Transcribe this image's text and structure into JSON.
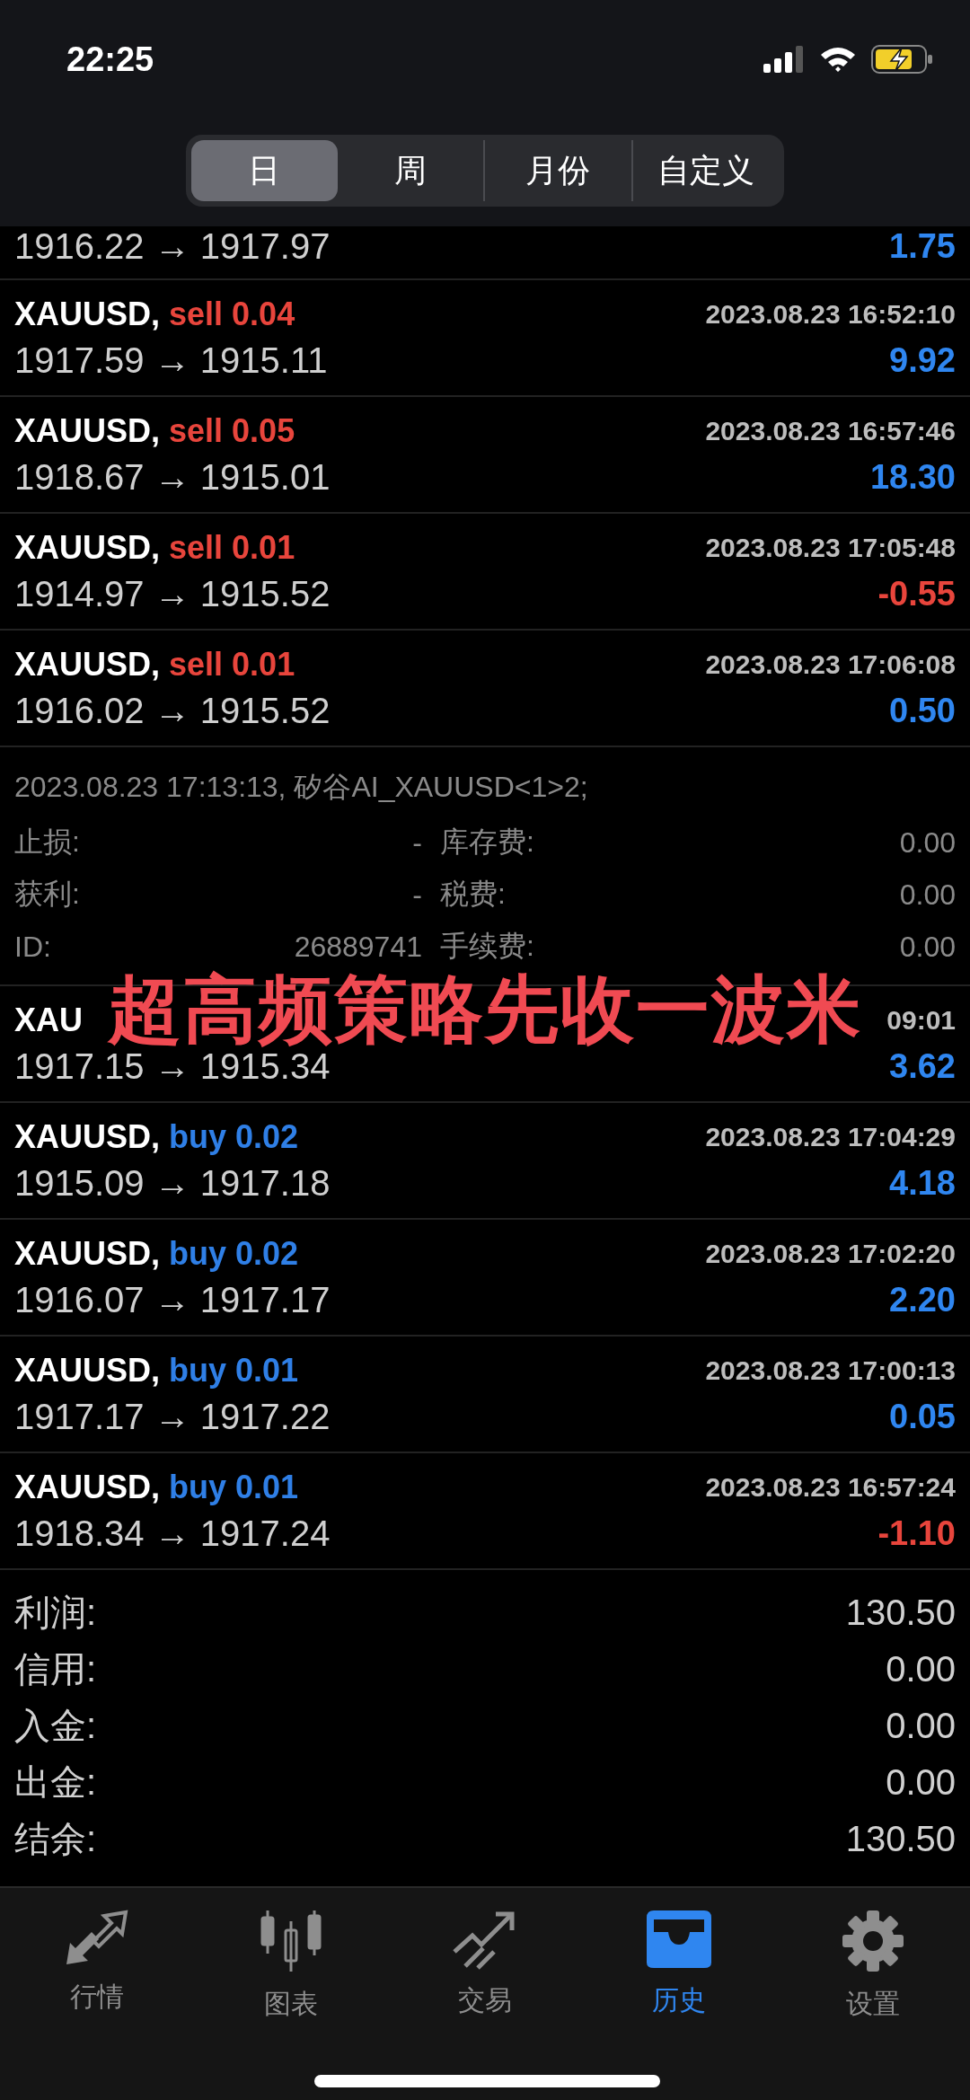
{
  "status_bar": {
    "time": "22:25"
  },
  "period_tabs": [
    {
      "label": "日",
      "selected": true
    },
    {
      "label": "周",
      "selected": false
    },
    {
      "label": "月份",
      "selected": false
    },
    {
      "label": "自定义",
      "selected": false
    }
  ],
  "trades": [
    {
      "kind": "partial",
      "prices": "1916.22 → 1917.97",
      "profit": "1.75",
      "negative": false
    },
    {
      "kind": "full",
      "symbol": "XAUUSD,",
      "side": "sell",
      "lots": "0.04",
      "time": "2023.08.23 16:52:10",
      "prices": "1917.59 → 1915.11",
      "profit": "9.92",
      "negative": false
    },
    {
      "kind": "full",
      "symbol": "XAUUSD,",
      "side": "sell",
      "lots": "0.05",
      "time": "2023.08.23 16:57:46",
      "prices": "1918.67 → 1915.01",
      "profit": "18.30",
      "negative": false
    },
    {
      "kind": "full",
      "symbol": "XAUUSD,",
      "side": "sell",
      "lots": "0.01",
      "time": "2023.08.23 17:05:48",
      "prices": "1914.97 → 1915.52",
      "profit": "-0.55",
      "negative": true
    },
    {
      "kind": "full",
      "symbol": "XAUUSD,",
      "side": "sell",
      "lots": "0.01",
      "time": "2023.08.23 17:06:08",
      "prices": "1916.02 → 1915.52",
      "profit": "0.50",
      "negative": false,
      "details": {
        "comment": "2023.08.23 17:13:13, 矽谷AI_XAUUSD<1>2;",
        "rows": [
          {
            "label": "止损:",
            "value": "-",
            "label_2": "库存费:",
            "value_2": "0.00"
          },
          {
            "label": "获利:",
            "value": "-",
            "label_2": "税费:",
            "value_2": "0.00"
          },
          {
            "label": "ID:",
            "value": "26889741",
            "label_2": "手续费:",
            "value_2": "0.00"
          }
        ]
      }
    },
    {
      "kind": "covered",
      "symbol": "XAU",
      "time": "09:01",
      "prices": "1917.15 → 1915.34",
      "profit": "3.62",
      "negative": false
    },
    {
      "kind": "full",
      "symbol": "XAUUSD,",
      "side": "buy",
      "lots": "0.02",
      "time": "2023.08.23 17:04:29",
      "prices": "1915.09 → 1917.18",
      "profit": "4.18",
      "negative": false
    },
    {
      "kind": "full",
      "symbol": "XAUUSD,",
      "side": "buy",
      "lots": "0.02",
      "time": "2023.08.23 17:02:20",
      "prices": "1916.07 → 1917.17",
      "profit": "2.20",
      "negative": false
    },
    {
      "kind": "full",
      "symbol": "XAUUSD,",
      "side": "buy",
      "lots": "0.01",
      "time": "2023.08.23 17:00:13",
      "prices": "1917.17 → 1917.22",
      "profit": "0.05",
      "negative": false
    },
    {
      "kind": "full",
      "symbol": "XAUUSD,",
      "side": "buy",
      "lots": "0.01",
      "time": "2023.08.23 16:57:24",
      "prices": "1918.34 → 1917.24",
      "profit": "-1.10",
      "negative": true
    }
  ],
  "overlay_caption": "超高频策略先收一波米",
  "summary": [
    {
      "label": "利润:",
      "value": "130.50"
    },
    {
      "label": "信用:",
      "value": "0.00"
    },
    {
      "label": "入金:",
      "value": "0.00"
    },
    {
      "label": "出金:",
      "value": "0.00"
    },
    {
      "label": "结余:",
      "value": "130.50"
    }
  ],
  "bottom_tabs": [
    {
      "kind": "quotes",
      "label": "行情",
      "selected": false
    },
    {
      "kind": "chart",
      "label": "图表",
      "selected": false
    },
    {
      "kind": "trade",
      "label": "交易",
      "selected": false
    },
    {
      "kind": "history",
      "label": "历史",
      "selected": true
    },
    {
      "kind": "settings",
      "label": "设置",
      "selected": false
    }
  ]
}
